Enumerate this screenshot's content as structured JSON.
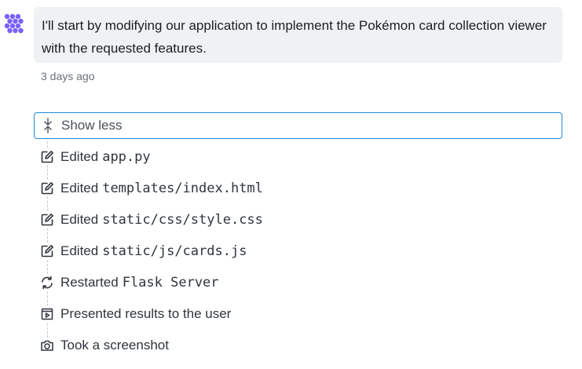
{
  "message": {
    "text": "I'll start by modifying our application to implement the Pokémon card collection viewer with the requested features.",
    "timestamp": "3 days ago",
    "avatar_icon": "agent-logo-icon",
    "accent_color": "#7b61ff"
  },
  "toggle": {
    "label": "Show less",
    "icon": "collapse-icon",
    "border_color": "#1f88d8"
  },
  "steps": [
    {
      "icon": "edit-icon",
      "label": "Edited",
      "code": "app.py"
    },
    {
      "icon": "edit-icon",
      "label": "Edited",
      "code": "templates/index.html"
    },
    {
      "icon": "edit-icon",
      "label": "Edited",
      "code": "static/css/style.css"
    },
    {
      "icon": "edit-icon",
      "label": "Edited",
      "code": "static/js/cards.js"
    },
    {
      "icon": "restart-icon",
      "label": "Restarted",
      "code": "Flask Server"
    },
    {
      "icon": "presentation-icon",
      "label": "Presented results to the user",
      "code": ""
    },
    {
      "icon": "camera-icon",
      "label": "Took a screenshot",
      "code": ""
    }
  ]
}
